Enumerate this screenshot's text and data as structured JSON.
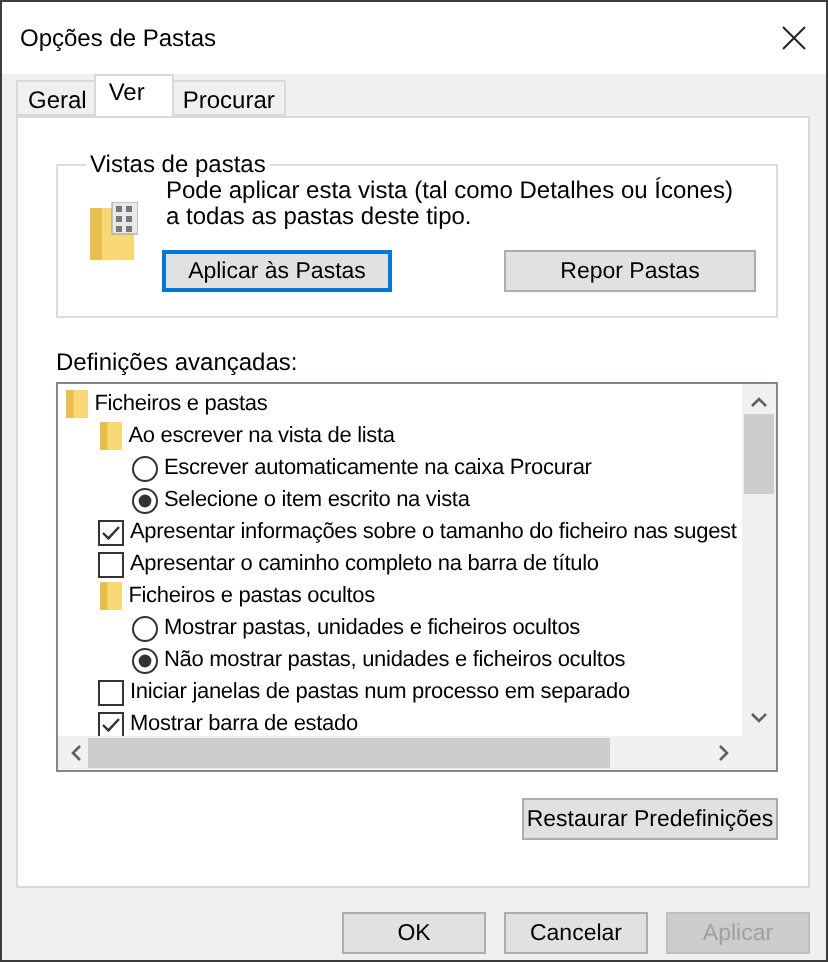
{
  "window": {
    "title": "Opções de Pastas"
  },
  "tabs": [
    {
      "label": "Geral",
      "selected": false
    },
    {
      "label": "Ver",
      "selected": true
    },
    {
      "label": "Procurar",
      "selected": false
    }
  ],
  "folder_views": {
    "title": "Vistas de pastas",
    "description": "Pode aplicar esta vista (tal como Detalhes ou Ícones) a todas as pastas deste tipo.",
    "buttons": [
      {
        "label": "Aplicar às Pastas",
        "focused": true
      },
      {
        "label": "Repor Pastas",
        "focused": false
      }
    ]
  },
  "advanced": {
    "label": "Definições avançadas:",
    "items": [
      {
        "kind": "folder",
        "label": "Ficheiros e pastas",
        "children": [
          {
            "kind": "folder",
            "label": "Ao escrever na vista de lista",
            "children": [
              {
                "kind": "radio",
                "label": "Escrever automaticamente na caixa Procurar",
                "selected": false
              },
              {
                "kind": "radio",
                "label": "Selecione o item escrito na vista",
                "selected": true
              }
            ]
          },
          {
            "kind": "checkbox",
            "label": "Apresentar informações sobre o tamanho do ficheiro nas sugest",
            "checked": true
          },
          {
            "kind": "checkbox",
            "label": "Apresentar o caminho completo na barra de título",
            "checked": false
          },
          {
            "kind": "folder",
            "label": "Ficheiros e pastas ocultos",
            "children": [
              {
                "kind": "radio",
                "label": "Mostrar pastas, unidades e ficheiros ocultos",
                "selected": false
              },
              {
                "kind": "radio",
                "label": "Não mostrar pastas, unidades e ficheiros ocultos",
                "selected": true
              }
            ]
          },
          {
            "kind": "checkbox",
            "label": "Iniciar janelas de pastas num processo em separado",
            "checked": false
          },
          {
            "kind": "checkbox",
            "label": "Mostrar barra de estado",
            "checked": true
          }
        ]
      }
    ],
    "restore_button": "Restaurar Predefinições"
  },
  "buttons": [
    {
      "label": "OK",
      "disabled": false
    },
    {
      "label": "Cancelar",
      "disabled": false
    },
    {
      "label": "Aplicar",
      "disabled": true
    }
  ]
}
